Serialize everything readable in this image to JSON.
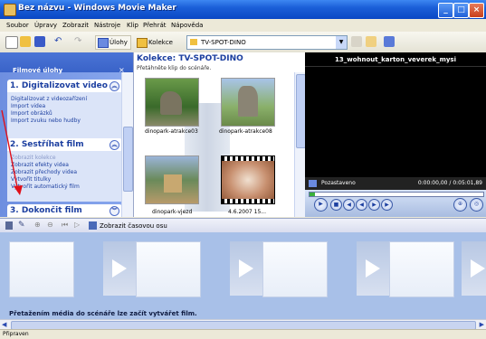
{
  "window": {
    "title": "Bez názvu - Windows Movie Maker"
  },
  "menu": [
    "Soubor",
    "Úpravy",
    "Zobrazit",
    "Nástroje",
    "Klip",
    "Přehrát",
    "Nápověda"
  ],
  "toolbar": {
    "tasks_label": "Úlohy",
    "collections_label": "Kolekce",
    "collection_value": "TV-SPOT-DINO"
  },
  "tasks_panel": {
    "title": "Filmové úlohy",
    "sections": [
      {
        "title": "1. Digitalizovat video",
        "items": [
          "Digitalizovat z videozařízení",
          "Import videa",
          "Import obrázků",
          "Import zvuku nebo hudby"
        ]
      },
      {
        "title": "2. Sestříhat film",
        "items": [
          "Zobrazit kolekce",
          "Zobrazit efekty videa",
          "Zobrazit přechody videa",
          "Vytvořit titulky",
          "Vytvořit automatický film"
        ]
      },
      {
        "title": "3. Dokončit film",
        "items": []
      }
    ]
  },
  "collection": {
    "title": "Kolekce: TV-SPOT-DINO",
    "subtitle": "Přetáhněte klip do scénáře.",
    "clips": [
      {
        "label": "dinopark-atrakce03"
      },
      {
        "label": "dinopark-atrakce08"
      },
      {
        "label": "dinopark-vjezd"
      },
      {
        "label": "4.6.2007 15..."
      }
    ]
  },
  "preview": {
    "title": "13_wohnout_karton_veverek_mysi",
    "status": "Pozastaveno",
    "time": "0:00:00,00 / 0:05:01,89"
  },
  "storyboard": {
    "timeline_label": "Zobrazit časovou osu",
    "hint": "Přetažením média do scénáře lze začít vytvářet film."
  },
  "statusbar": {
    "text": "Připraven"
  },
  "colors": {
    "titlebar": "#1b5fd8",
    "task_panel": "#7a98e6",
    "link": "#1c3fa0",
    "annotation_arrow": "#e0101a"
  }
}
